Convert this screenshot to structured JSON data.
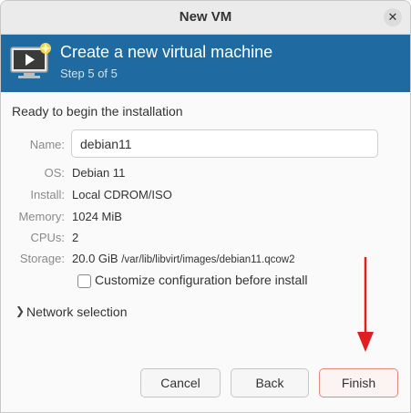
{
  "window": {
    "title": "New VM",
    "close_glyph": "✕"
  },
  "banner": {
    "title": "Create a new virtual machine",
    "step": "Step 5 of 5",
    "icon": "vm-monitor-icon"
  },
  "summary": {
    "heading": "Ready to begin the installation",
    "name_label": "Name:",
    "name_value": "debian11",
    "os_label": "OS:",
    "os_value": "Debian 11",
    "install_label": "Install:",
    "install_value": "Local CDROM/ISO",
    "memory_label": "Memory:",
    "memory_value": "1024 MiB",
    "cpus_label": "CPUs:",
    "cpus_value": "2",
    "storage_label": "Storage:",
    "storage_size": "20.0 GiB",
    "storage_path": "/var/lib/libvirt/images/debian11.qcow2"
  },
  "customize": {
    "label": "Customize configuration before install",
    "checked": false
  },
  "network": {
    "label": "Network selection",
    "expander_glyph": "❯"
  },
  "buttons": {
    "cancel": "Cancel",
    "back": "Back",
    "finish": "Finish"
  },
  "colors": {
    "banner": "#1f6aa0",
    "annotation_arrow": "#e02020"
  }
}
